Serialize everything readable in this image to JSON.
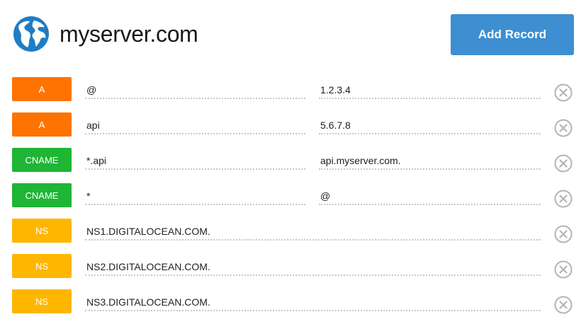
{
  "header": {
    "domain": "myserver.com",
    "add_record_label": "Add Record",
    "globe_icon": "globe-icon"
  },
  "colors": {
    "A": "#ff7300",
    "CNAME": "#1fb535",
    "NS": "#ffb600",
    "button": "#3d8fd1"
  },
  "records": [
    {
      "type": "A",
      "name": "@",
      "value": "1.2.3.4"
    },
    {
      "type": "A",
      "name": "api",
      "value": "5.6.7.8"
    },
    {
      "type": "CNAME",
      "name": "*.api",
      "value": "api.myserver.com."
    },
    {
      "type": "CNAME",
      "name": "*",
      "value": "@"
    },
    {
      "type": "NS",
      "value": "NS1.DIGITALOCEAN.COM."
    },
    {
      "type": "NS",
      "value": "NS2.DIGITALOCEAN.COM."
    },
    {
      "type": "NS",
      "value": "NS3.DIGITALOCEAN.COM."
    }
  ]
}
